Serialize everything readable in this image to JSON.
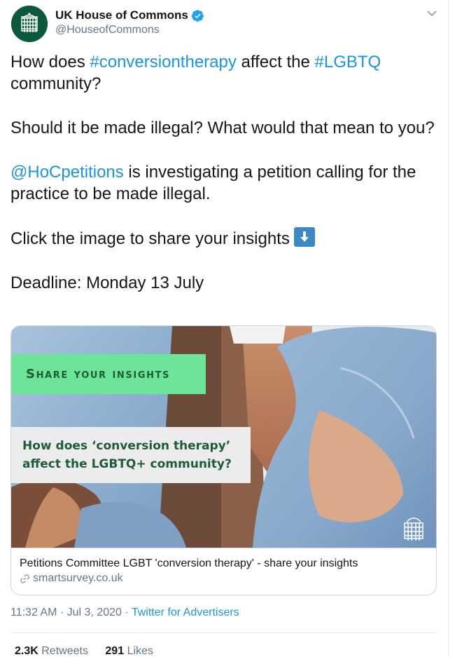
{
  "account": {
    "display_name": "UK House of Commons",
    "handle": "@HouseofCommons",
    "avatar_icon": "portcullis-icon",
    "verified_icon": "verified-badge-icon"
  },
  "tweet": {
    "p1_a": "How does ",
    "p1_tag1": "#conversiontherapy",
    "p1_b": " affect the ",
    "p1_tag2": "#LGBTQ",
    "p1_c": " community?",
    "p2": "Should it be made illegal? What would that mean to you?",
    "p3_mention": "@HoCpetitions",
    "p3_rest": " is investigating a petition calling for the practice to be made illegal.",
    "p4": "Click the image to share your insights",
    "p4_emoji": "down-arrow-emoji",
    "p5": "Deadline: Monday 13 July"
  },
  "card": {
    "banner_heading": "Share your insights",
    "banner_question": "How does ‘conversion therapy’ affect the LGBTQ+ community?",
    "title": "Petitions Committee LGBT 'conversion therapy' - share your insights",
    "domain": "smartsurvey.co.uk",
    "link_icon": "link-icon"
  },
  "meta": {
    "time": "11:32 AM",
    "separator1": " · ",
    "date": "Jul 3, 2020",
    "separator2": " · ",
    "source": "Twitter for Advertisers"
  },
  "stats": {
    "retweets_count": "2.3K",
    "retweets_label": "Retweets",
    "likes_count": "291",
    "likes_label": "Likes"
  },
  "colors": {
    "link": "#1b95e0",
    "muted": "#657786",
    "banner_green": "#6ce49a",
    "banner_text": "#1e5c37",
    "avatar_bg": "#0b5a3c"
  }
}
